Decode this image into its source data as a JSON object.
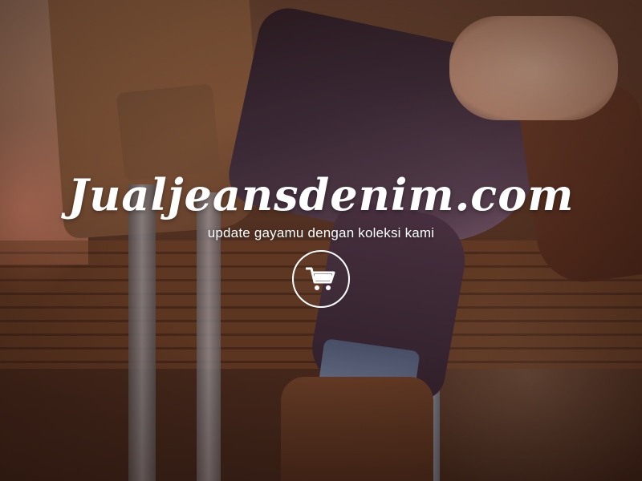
{
  "hero": {
    "brand_title": "Jualjeansdenim.com",
    "tagline": "update gayamu dengan koleksi kami",
    "cta_icon": "shopping-cart-icon",
    "text_color": "#ffffff"
  }
}
